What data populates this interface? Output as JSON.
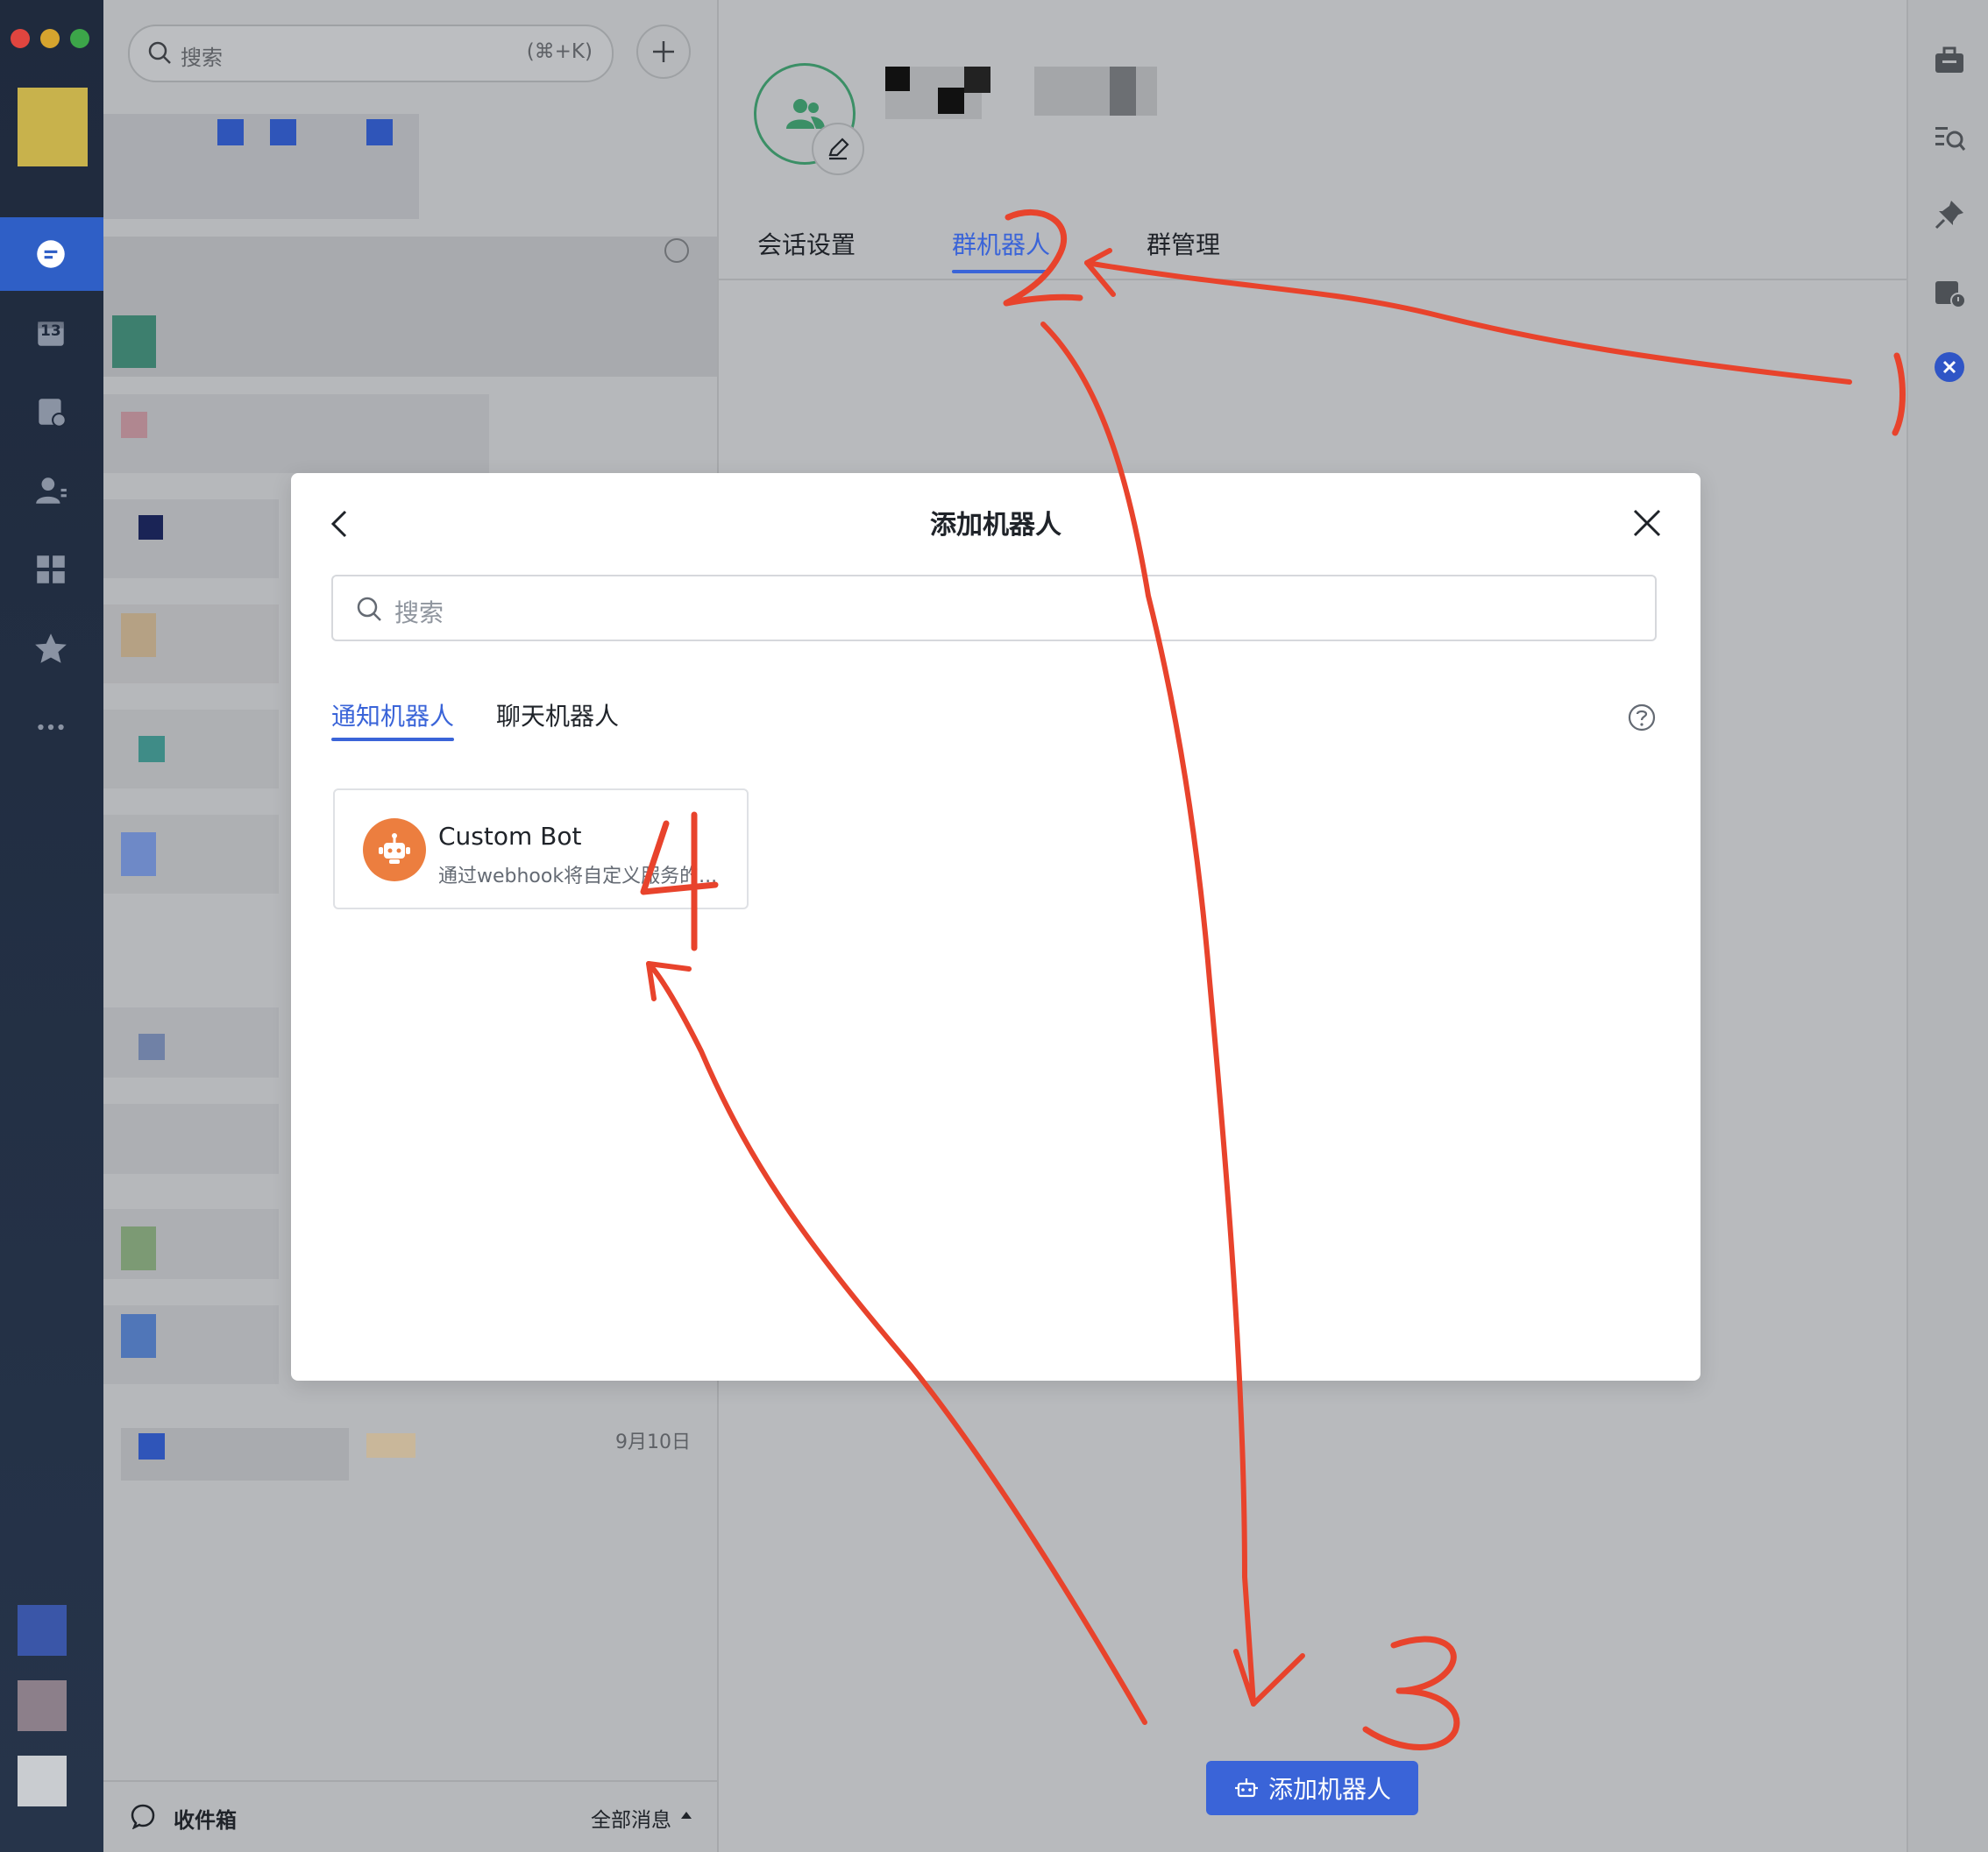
{
  "chat_list": {
    "search_placeholder": "搜索",
    "search_shortcut": "(⌘+K)",
    "date_label": "9月10日",
    "inbox_label": "收件箱",
    "filter_label": "全部消息"
  },
  "nav": {
    "calendar_day": "13"
  },
  "group": {
    "tabs": [
      "会话设置",
      "群机器人",
      "群管理"
    ],
    "active_tab": "群机器人",
    "add_bot_button": "添加机器人"
  },
  "modal": {
    "title": "添加机器人",
    "search_placeholder": "搜索",
    "tabs": [
      "通知机器人",
      "聊天机器人"
    ],
    "active_tab": "通知机器人",
    "bot": {
      "name": "Custom Bot",
      "description": "通过webhook将自定义服务的..."
    }
  },
  "annotations": [
    "1",
    "2",
    "3",
    "4"
  ],
  "colors": {
    "accent": "#3a64d8",
    "annotation_red": "#e8432c",
    "bot_avatar": "#ec7e3f",
    "group_avatar": "#3b8f66"
  }
}
